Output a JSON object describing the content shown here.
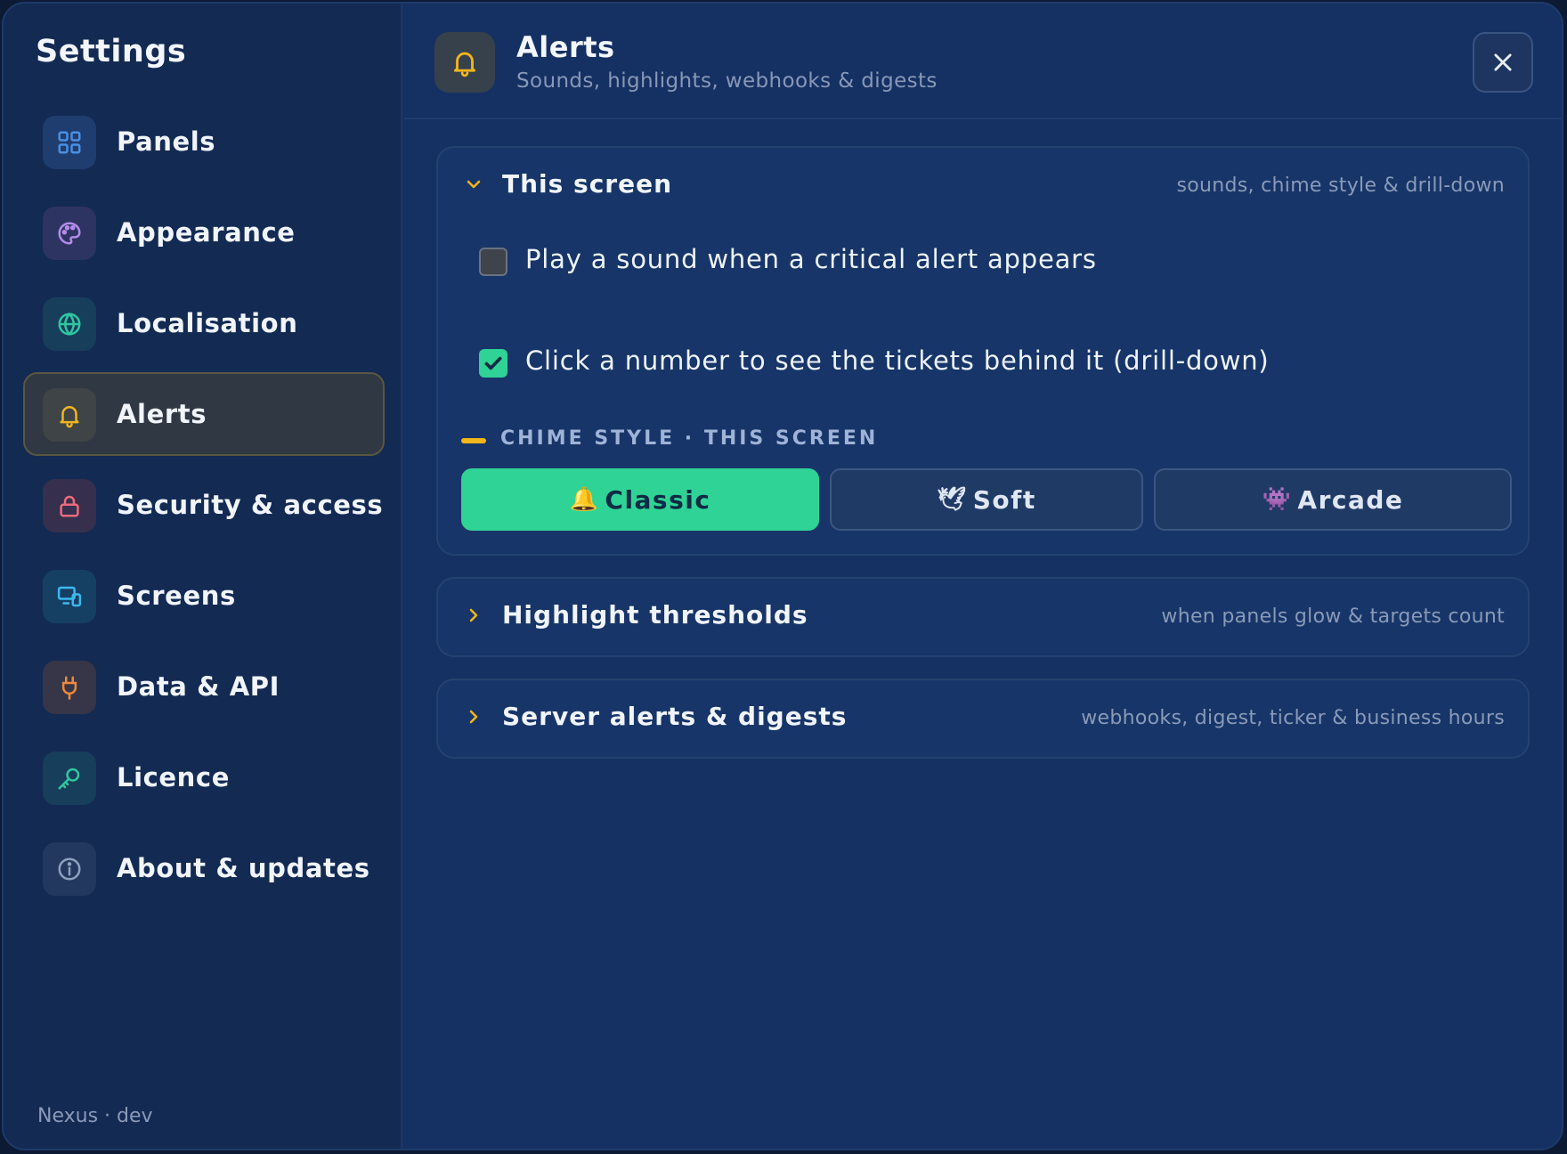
{
  "sidebar": {
    "title": "Settings",
    "items": [
      {
        "label": "Panels",
        "icon": "grid-icon",
        "color": "#4a90e2",
        "bg": "#1f3d6e"
      },
      {
        "label": "Appearance",
        "icon": "palette-icon",
        "color": "#b48be8",
        "bg": "#2d3462"
      },
      {
        "label": "Localisation",
        "icon": "globe-icon",
        "color": "#2fc7a0",
        "bg": "#173e5a"
      },
      {
        "label": "Alerts",
        "icon": "bell-icon",
        "color": "#f2b51d",
        "bg": "#3f4547",
        "active": true
      },
      {
        "label": "Security & access",
        "icon": "lock-icon",
        "color": "#ef6a7a",
        "bg": "#362f4e"
      },
      {
        "label": "Screens",
        "icon": "devices-icon",
        "color": "#3cb8ee",
        "bg": "#163f64"
      },
      {
        "label": "Data & API",
        "icon": "plug-icon",
        "color": "#f0893a",
        "bg": "#363648"
      },
      {
        "label": "Licence",
        "icon": "key-icon",
        "color": "#2fc7a0",
        "bg": "#173e5a"
      },
      {
        "label": "About & updates",
        "icon": "info-icon",
        "color": "#8fa0bf",
        "bg": "#22385e"
      }
    ],
    "footer": "Nexus · dev"
  },
  "header": {
    "title": "Alerts",
    "subtitle": "Sounds, highlights, webhooks & digests",
    "close_icon": "close-icon"
  },
  "sections": {
    "this_screen": {
      "title": "This screen",
      "hint": "sounds, chime style & drill-down",
      "expanded": true,
      "checks": [
        {
          "label": "Play a sound when a critical alert appears",
          "checked": false
        },
        {
          "label": "Click a number to see the tickets behind it (drill-down)",
          "checked": true
        }
      ],
      "chime_label": "CHIME STYLE · THIS SCREEN",
      "chime_options": [
        {
          "emoji": "🔔",
          "label": "Classic",
          "selected": true
        },
        {
          "emoji": "🕊",
          "label": "Soft",
          "selected": false
        },
        {
          "emoji": "👾",
          "label": "Arcade",
          "selected": false
        }
      ]
    },
    "highlight_thresholds": {
      "title": "Highlight thresholds",
      "hint": "when panels glow & targets count",
      "expanded": false
    },
    "server_alerts": {
      "title": "Server alerts & digests",
      "hint": "webhooks, digest, ticker & business hours",
      "expanded": false
    }
  },
  "colors": {
    "accent": "#2fd396",
    "alert": "#f2b51d",
    "chevron": "#f2b51d"
  }
}
